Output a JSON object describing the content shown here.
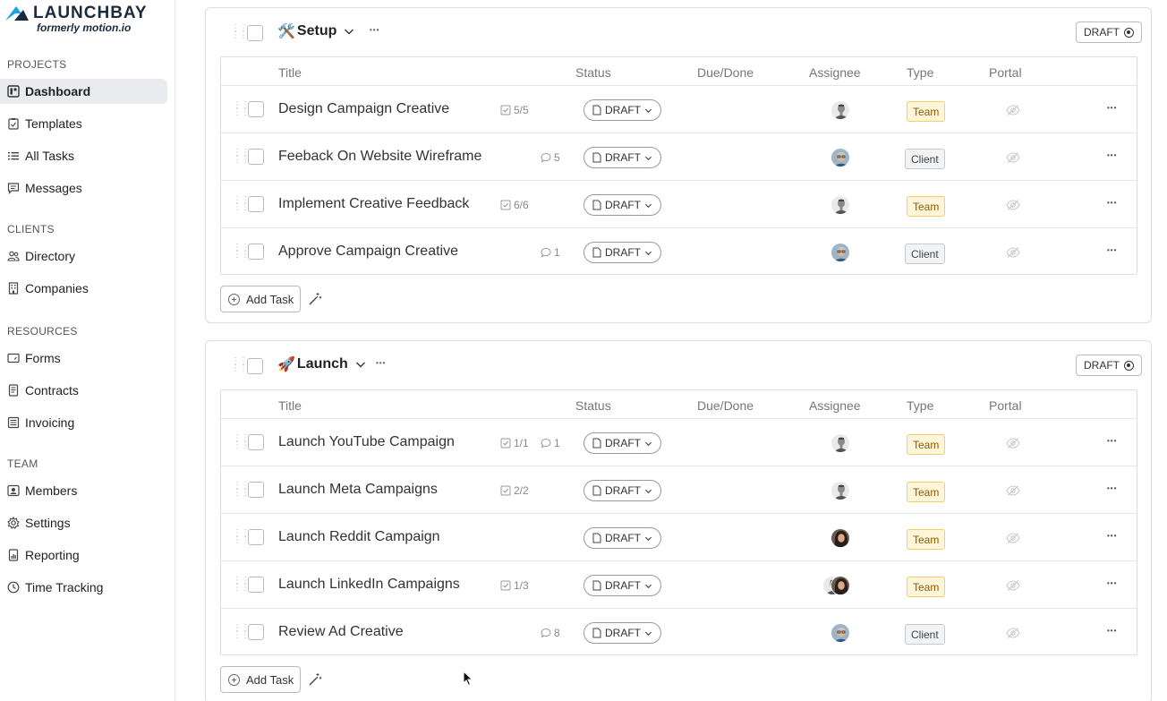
{
  "brand": {
    "name": "LAUNCHBAY",
    "tagline": "formerly motion.io"
  },
  "sidebar": {
    "sections": [
      {
        "label": "PROJECTS",
        "items": [
          {
            "label": "Dashboard",
            "icon": "dashboard-icon",
            "active": true
          },
          {
            "label": "Templates",
            "icon": "clipboard-icon"
          },
          {
            "label": "All Tasks",
            "icon": "list-icon"
          },
          {
            "label": "Messages",
            "icon": "message-icon"
          }
        ]
      },
      {
        "label": "CLIENTS",
        "items": [
          {
            "label": "Directory",
            "icon": "people-icon"
          },
          {
            "label": "Companies",
            "icon": "building-icon"
          }
        ]
      },
      {
        "label": "RESOURCES",
        "items": [
          {
            "label": "Forms",
            "icon": "form-icon"
          },
          {
            "label": "Contracts",
            "icon": "document-icon"
          },
          {
            "label": "Invoicing",
            "icon": "invoice-icon"
          }
        ]
      },
      {
        "label": "TEAM",
        "items": [
          {
            "label": "Members",
            "icon": "member-icon"
          },
          {
            "label": "Settings",
            "icon": "gear-icon"
          },
          {
            "label": "Reporting",
            "icon": "report-icon"
          },
          {
            "label": "Time Tracking",
            "icon": "clock-icon"
          }
        ]
      }
    ]
  },
  "columns": {
    "title": "Title",
    "status": "Status",
    "due": "Due/Done",
    "assignee": "Assignee",
    "type": "Type",
    "portal": "Portal"
  },
  "draft_label": "DRAFT",
  "add_task_label": "Add Task",
  "stages": [
    {
      "emoji": "🛠️",
      "name": "Setup",
      "status": "DRAFT",
      "tasks": [
        {
          "title": "Design Campaign Creative",
          "checklist": "5/5",
          "comments": null,
          "status": "DRAFT",
          "assignees": [
            "man-gray"
          ],
          "type": "Team"
        },
        {
          "title": "Feeback On Website Wireframe",
          "checklist": null,
          "comments": "5",
          "status": "DRAFT",
          "assignees": [
            "man-glasses"
          ],
          "type": "Client"
        },
        {
          "title": "Implement Creative Feedback",
          "checklist": "6/6",
          "comments": null,
          "status": "DRAFT",
          "assignees": [
            "man-gray"
          ],
          "type": "Team"
        },
        {
          "title": "Approve Campaign Creative",
          "checklist": null,
          "comments": "1",
          "status": "DRAFT",
          "assignees": [
            "man-glasses"
          ],
          "type": "Client"
        }
      ]
    },
    {
      "emoji": "🚀",
      "name": "Launch",
      "status": "DRAFT",
      "tasks": [
        {
          "title": "Launch YouTube Campaign",
          "checklist": "1/1",
          "comments": "1",
          "status": "DRAFT",
          "assignees": [
            "man-gray"
          ],
          "type": "Team"
        },
        {
          "title": "Launch Meta Campaigns",
          "checklist": "2/2",
          "comments": null,
          "status": "DRAFT",
          "assignees": [
            "man-gray"
          ],
          "type": "Team"
        },
        {
          "title": "Launch Reddit Campaign",
          "checklist": null,
          "comments": null,
          "status": "DRAFT",
          "assignees": [
            "woman"
          ],
          "type": "Team"
        },
        {
          "title": "Launch LinkedIn Campaigns",
          "checklist": "1/3",
          "comments": null,
          "status": "DRAFT",
          "assignees": [
            "man-gray",
            "woman"
          ],
          "type": "Team"
        },
        {
          "title": "Review Ad Creative",
          "checklist": null,
          "comments": "8",
          "status": "DRAFT",
          "assignees": [
            "man-glasses"
          ],
          "type": "Client"
        }
      ]
    }
  ],
  "colors": {
    "brand": "#1aa3e0",
    "team_badge": "#fff6d9",
    "client_badge": "#f2f3f5",
    "active_nav": "#e9ebee"
  }
}
